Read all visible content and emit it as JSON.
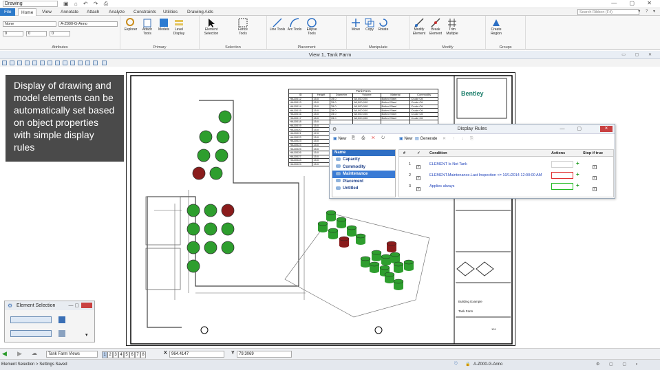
{
  "titlebar": {
    "title": "Drawing"
  },
  "ribbon": {
    "tabs": [
      "File",
      "Home",
      "View",
      "Annotate",
      "Attach",
      "Analyze",
      "Constraints",
      "Utilities",
      "Drawing Aids"
    ],
    "search_placeholder": "Search Ribbon (F4)",
    "attributes": {
      "level": "None",
      "model": "A-Z000-G-Anno",
      "label": "Attributes",
      "v1": "0",
      "v2": "0",
      "v3": "0"
    },
    "groups": {
      "primary": "Primary",
      "selection": "Selection",
      "placement": "Placement",
      "manipulate": "Manipulate",
      "modify": "Modify",
      "groups": "Groups"
    },
    "buttons": {
      "explorer": "Explorer",
      "attach_tools": "Attach Tools",
      "models": "Models",
      "level_display": "Level Display",
      "element_selection": "Element Selection",
      "fence_tools": "Fence Tools",
      "line_tools": "Line Tools",
      "arc_tools": "Arc Tools",
      "ellipse_tools": "Ellipse Tools",
      "move": "Move",
      "copy": "Copy",
      "rotate": "Rotate",
      "modify_element": "Modify Element",
      "break_element": "Break Element",
      "trim_multiple": "Trim Multiple",
      "create_region": "Create Region"
    }
  },
  "view": {
    "title": "View 1, Tank Farm"
  },
  "callout": "Display of drawing and model elements can be automatically set based on object properties with simple display rules",
  "tank_table": {
    "title": "Tank Farm",
    "headers": [
      "ID",
      "Height",
      "Diameter",
      "Volume",
      "Material",
      "Commodity"
    ],
    "rows": [
      [
        "HA10012",
        "15.0",
        "78.0",
        "68,000,000",
        "Bolted Steel",
        "Crude Oil"
      ],
      [
        "HA10013",
        "15.0",
        "78.0",
        "68,000,000",
        "Bolted Steel",
        "Crude Oil"
      ],
      [
        "HA10014",
        "15.0",
        "78.0",
        "68,000,000",
        "Bolted Steel",
        "Crude Oil"
      ],
      [
        "HA10015",
        "15.0",
        "78.0",
        "68,000,000",
        "Bolted Steel",
        "Crude Oil"
      ],
      [
        "HA10016",
        "15.0",
        "78.0",
        "68,000,000",
        "Bolted Steel",
        "Crude Oil"
      ],
      [
        "HA10017",
        "15.0",
        "78.0",
        "68,000,000",
        "Bolted Steel",
        "Crude Oil"
      ],
      [
        "HA10018",
        "15.0",
        "",
        "",
        "",
        ""
      ],
      [
        "HA10019",
        "15.0",
        "",
        "",
        "",
        ""
      ],
      [
        "HA10020",
        "15.0",
        "",
        "",
        "",
        ""
      ],
      [
        "HA10021",
        "12.0",
        "",
        "",
        "",
        ""
      ],
      [
        "HA10022",
        "15.0",
        "",
        "",
        "",
        ""
      ],
      [
        "HA10023",
        "15.0",
        "",
        "",
        "",
        ""
      ],
      [
        "HA10024",
        "15.0",
        "",
        "",
        "",
        ""
      ],
      [
        "HA10025",
        "15.0",
        "",
        "",
        "",
        ""
      ],
      [
        "HA10026",
        "15.0",
        "",
        "",
        "",
        ""
      ],
      [
        "HA10027",
        "15.0",
        "",
        "",
        "",
        ""
      ],
      [
        "HA10028",
        "15.0",
        "",
        "",
        "",
        ""
      ],
      [
        "HA10029",
        "15.0",
        "",
        "",
        "",
        ""
      ]
    ]
  },
  "display_rules": {
    "title": "Display Rules",
    "toolbar_left": {
      "new": "New"
    },
    "toolbar_right": {
      "new": "New",
      "generate": "Generate"
    },
    "list_header": "Name",
    "rule_sets": [
      "Capacity",
      "Commodity",
      "Maintenance",
      "Placement",
      "Untitled"
    ],
    "selected_rule_set": "Maintenance",
    "grid_headers": {
      "num": "#",
      "check": "✓",
      "condition": "Condition",
      "actions": "Actions",
      "stop": "Stop if true"
    },
    "rules": [
      {
        "num": "1",
        "condition": "ELEMENT Is Not Tank",
        "action_color": "#d0d0d0"
      },
      {
        "num": "2",
        "condition": "ELEMENT.Maintenance.Last Inspection <= 10/1/2014 12:00:00 AM",
        "action_color": "#e03030"
      },
      {
        "num": "3",
        "condition": "Applies always",
        "action_color": "#22bb22"
      }
    ]
  },
  "title_block": {
    "logo": "Bentley",
    "project": "Building Example",
    "sheet": "Tank Farm",
    "sheet_no": "101"
  },
  "element_selection": {
    "title": "Element Selection"
  },
  "navbar": {
    "views_label": "Tank Farm Views",
    "view_numbers": [
      "1",
      "2",
      "3",
      "4",
      "5",
      "6",
      "7",
      "8"
    ],
    "x_label": "X",
    "x_value": "964.4147",
    "y_label": "Y",
    "y_value": "79.3069"
  },
  "status": {
    "message": "Element Selection > Settings Saved",
    "model": "A-Z000-G-Anno"
  },
  "colors": {
    "accent": "#2b79c9",
    "tank_green": "#2e9e2e",
    "tank_red": "#8a1c1c"
  }
}
